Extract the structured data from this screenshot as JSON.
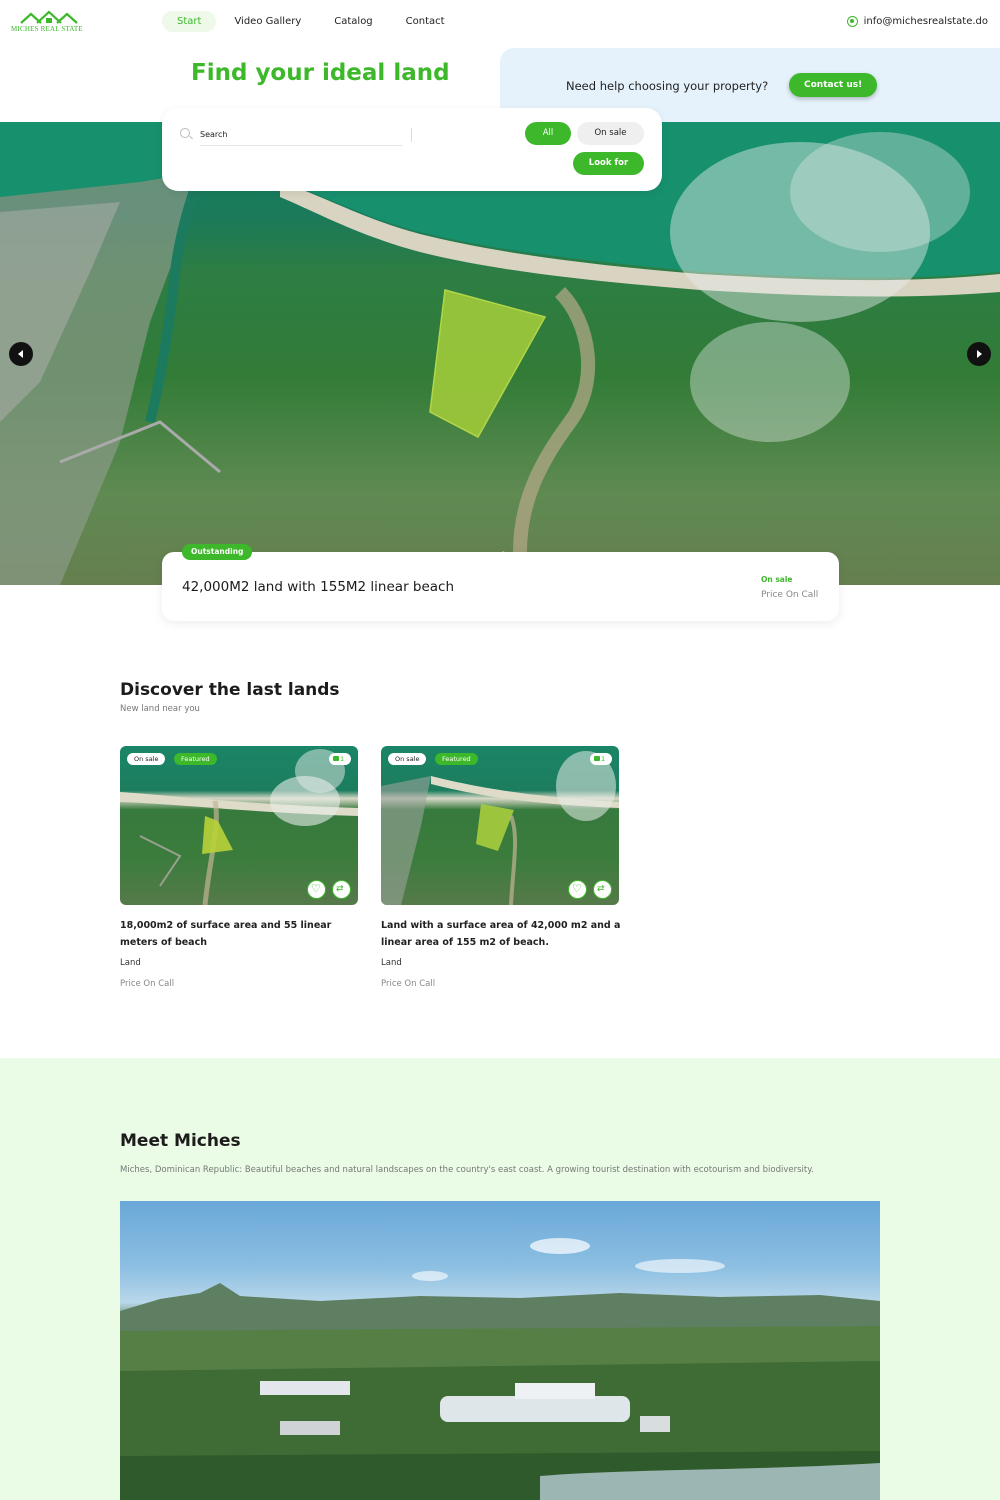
{
  "brand": {
    "logo_text": "MICHES REAL STATE",
    "accent": "#3db82a"
  },
  "nav": {
    "items": [
      "Start",
      "Video Gallery",
      "Catalog",
      "Contact"
    ],
    "active": "Start"
  },
  "header": {
    "email": "info@michesrealstate.do",
    "contact_icon": "whatsapp-icon"
  },
  "hero": {
    "title": "Find your ideal land",
    "help_text": "Need help choosing your property?",
    "contact_button": "Contact us!"
  },
  "search": {
    "placeholder": "Search",
    "filter_all": "All",
    "filter_on_sale": "On sale",
    "submit": "Look for"
  },
  "featured": {
    "badge": "Outstanding",
    "title": "42,000M2 land with 155M2 linear beach",
    "status": "On sale",
    "price": "Price On Call"
  },
  "discover": {
    "title": "Discover the last lands",
    "subtitle": "New land near you",
    "cards": [
      {
        "status": "On sale",
        "badge": "Featured",
        "photos": "1",
        "title": "18,000m2 of surface area and 55 linear meters of beach",
        "type": "Land",
        "price": "Price On Call"
      },
      {
        "status": "On sale",
        "badge": "Featured",
        "photos": "1",
        "title": "Land with a surface area of 42,000 m2 and a linear area of 155 m2 of beach.",
        "type": "Land",
        "price": "Price On Call"
      }
    ]
  },
  "meet": {
    "title": "Meet Miches",
    "description": "Miches, Dominican Republic: Beautiful beaches and natural landscapes on the country's east coast. A growing tourist destination with ecotourism and biodiversity."
  }
}
